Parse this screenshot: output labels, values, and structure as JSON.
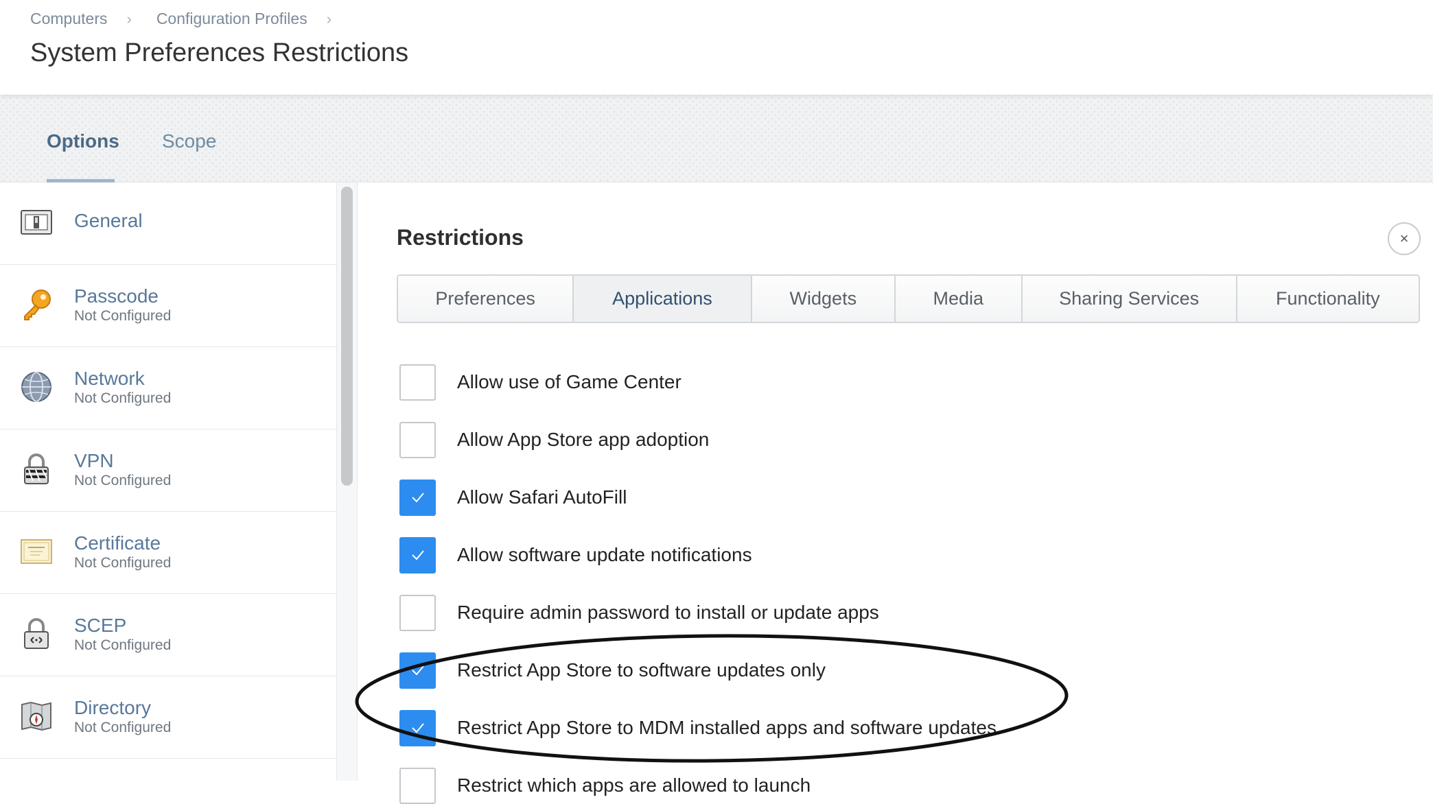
{
  "breadcrumb": [
    "Computers",
    "Configuration Profiles"
  ],
  "breadcrumb_separator": "›",
  "page_title": "System Preferences Restrictions",
  "tabs": [
    {
      "label": "Options",
      "active": true
    },
    {
      "label": "Scope",
      "active": false
    }
  ],
  "sidebar": {
    "items": [
      {
        "name": "General",
        "status": "",
        "icon": "switch-icon"
      },
      {
        "name": "Passcode",
        "status": "Not Configured",
        "icon": "key-icon"
      },
      {
        "name": "Network",
        "status": "Not Configured",
        "icon": "globe-icon"
      },
      {
        "name": "VPN",
        "status": "Not Configured",
        "icon": "vpn-lock-icon"
      },
      {
        "name": "Certificate",
        "status": "Not Configured",
        "icon": "certificate-icon"
      },
      {
        "name": "SCEP",
        "status": "Not Configured",
        "icon": "scep-lock-icon"
      },
      {
        "name": "Directory",
        "status": "Not Configured",
        "icon": "directory-compass-icon"
      }
    ]
  },
  "main": {
    "section_title": "Restrictions",
    "close_label": "×",
    "segments": [
      {
        "label": "Preferences",
        "active": false
      },
      {
        "label": "Applications",
        "active": true
      },
      {
        "label": "Widgets",
        "active": false
      },
      {
        "label": "Media",
        "active": false
      },
      {
        "label": "Sharing Services",
        "active": false
      },
      {
        "label": "Functionality",
        "active": false
      }
    ],
    "options": [
      {
        "label": "Allow use of Game Center",
        "checked": false
      },
      {
        "label": "Allow App Store app adoption",
        "checked": false
      },
      {
        "label": "Allow Safari AutoFill",
        "checked": true
      },
      {
        "label": "Allow software update notifications",
        "checked": true
      },
      {
        "label": "Require admin password to install or update apps",
        "checked": false
      },
      {
        "label": "Restrict App Store to software updates only",
        "checked": true
      },
      {
        "label": "Restrict App Store to MDM installed apps and software updates",
        "checked": true
      },
      {
        "label": "Restrict which apps are allowed to launch",
        "checked": false
      }
    ]
  },
  "colors": {
    "accent": "#2d8cf0",
    "link": "#58789a"
  }
}
